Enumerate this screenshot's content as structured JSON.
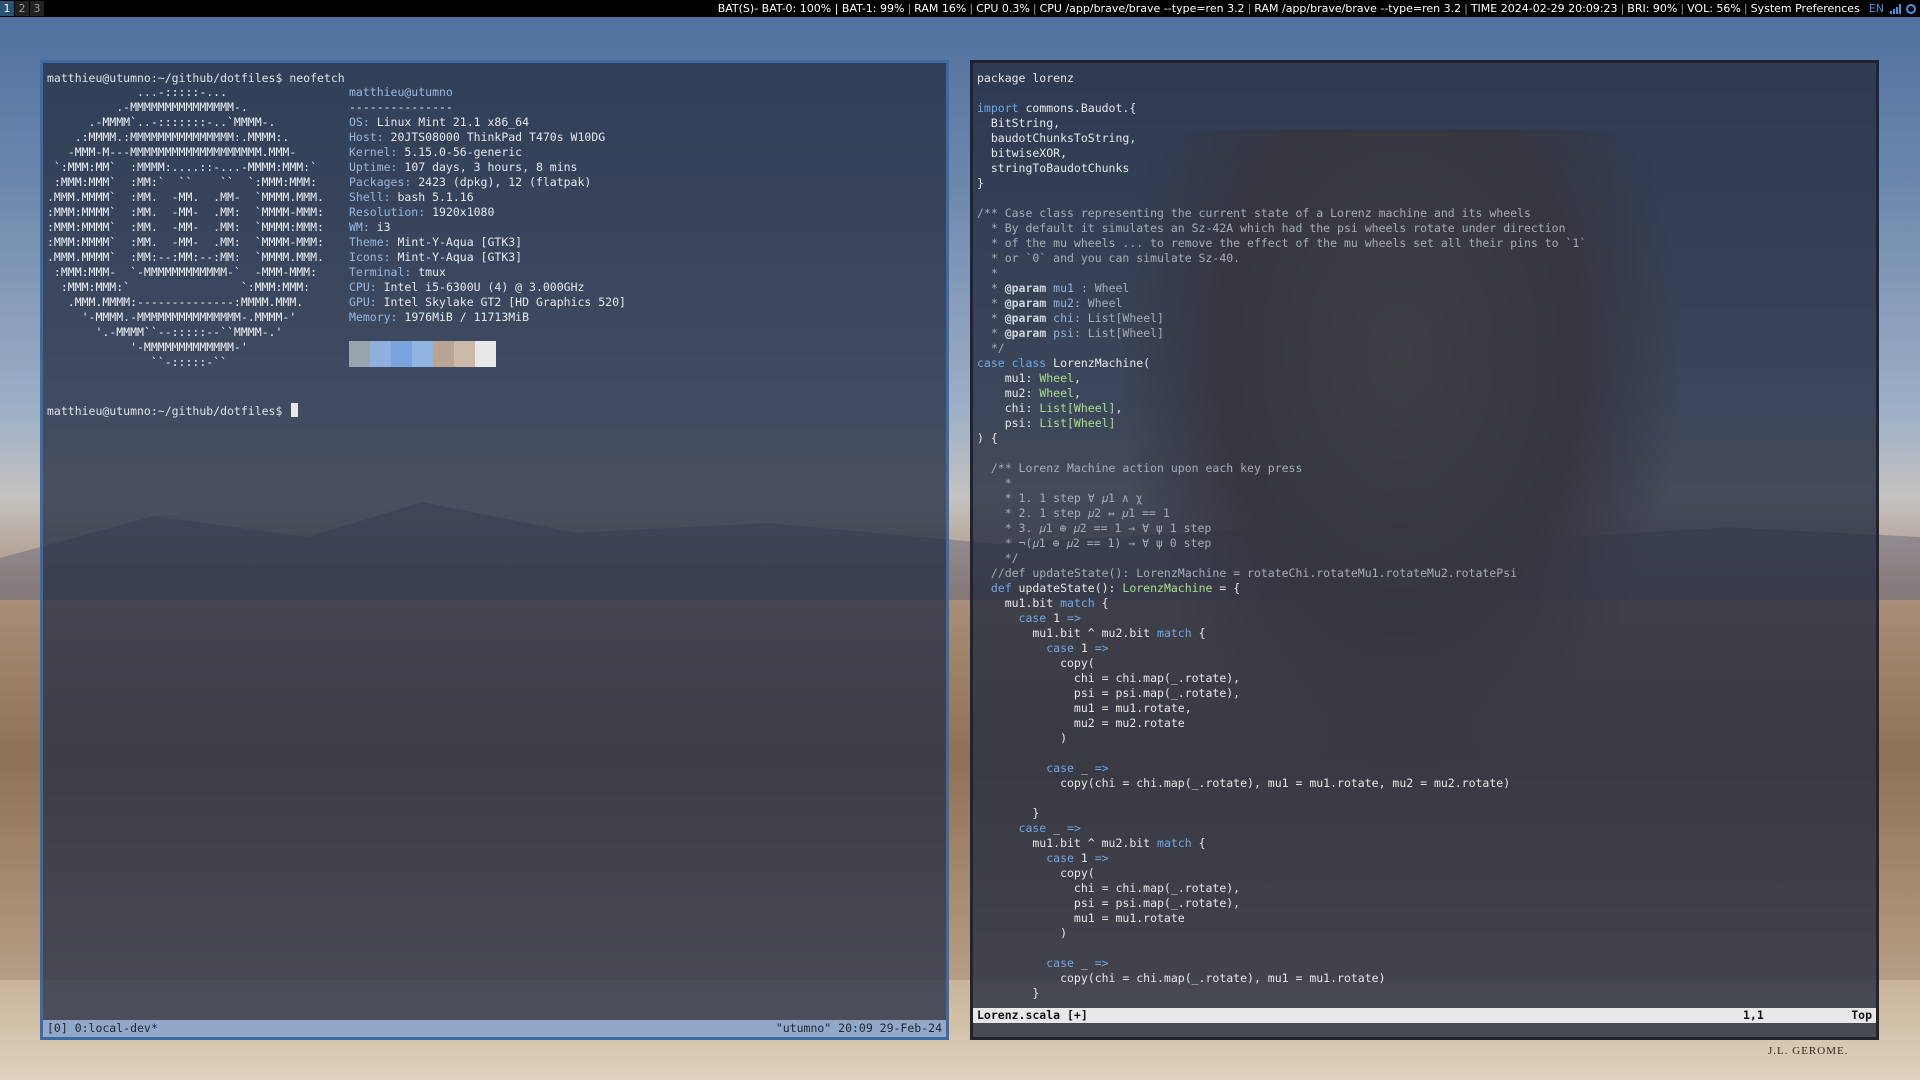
{
  "topbar": {
    "workspaces": [
      "1",
      "2",
      "3"
    ],
    "status": [
      "BAT(S)- BAT-0: 100% | BAT-1: 99%",
      "RAM 16%",
      "CPU 0.3%",
      "CPU /app/brave/brave --type=ren 3.2",
      "RAM /app/brave/brave --type=ren 3.2",
      "TIME 2024-02-29 20:09:23",
      "BRI: 90%",
      "VOL: 56%",
      "System Preferences"
    ],
    "lang": "EN",
    "tray_icons": [
      "signal-bars-icon",
      "audio-icon"
    ]
  },
  "terminal": {
    "prompt_cmd": "matthieu@utumno:~/github/dotfiles$ neofetch",
    "prompt_empty": "matthieu@utumno:~/github/dotfiles$ ",
    "user_host": "matthieu@utumno",
    "separator": "---------------",
    "info": [
      {
        "k": "OS",
        "v": "Linux Mint 21.1 x86_64"
      },
      {
        "k": "Host",
        "v": "20JTS08000 ThinkPad T470s W10DG"
      },
      {
        "k": "Kernel",
        "v": "5.15.0-56-generic"
      },
      {
        "k": "Uptime",
        "v": "107 days, 3 hours, 8 mins"
      },
      {
        "k": "Packages",
        "v": "2423 (dpkg), 12 (flatpak)"
      },
      {
        "k": "Shell",
        "v": "bash 5.1.16"
      },
      {
        "k": "Resolution",
        "v": "1920x1080"
      },
      {
        "k": "WM",
        "v": "i3"
      },
      {
        "k": "Theme",
        "v": "Mint-Y-Aqua [GTK3]"
      },
      {
        "k": "Icons",
        "v": "Mint-Y-Aqua [GTK3]"
      },
      {
        "k": "Terminal",
        "v": "tmux"
      },
      {
        "k": "CPU",
        "v": "Intel i5-6300U (4) @ 3.000GHz"
      },
      {
        "k": "GPU",
        "v": "Intel Skylake GT2 [HD Graphics 520]"
      },
      {
        "k": "Memory",
        "v": "1976MiB / 11713MiB"
      }
    ],
    "ascii": [
      "             ...-:::::-...",
      "          .-MMMMMMMMMMMMMMM-.",
      "      .-MMMM`..-:::::::-..`MMMM-.",
      "    .:MMMM.:MMMMMMMMMMMMMMM:.MMMM:.",
      "   -MMM-M---MMMMMMMMMMMMMMMMMMM.MMM-",
      " `:MMM:MM`  :MMMM:....::-...-MMMM:MMM:`",
      " :MMM:MMM`  :MM:`  ``    ``  `:MMM:MMM:",
      ".MMM.MMMM`  :MM.  -MM.  .MM-  `MMMM.MMM.",
      ":MMM:MMMM`  :MM.  -MM-  .MM:  `MMMM-MMM:",
      ":MMM:MMMM`  :MM.  -MM-  .MM:  `MMMM:MMM:",
      ":MMM:MMMM`  :MM.  -MM-  .MM:  `MMMM-MMM:",
      ".MMM.MMMM`  :MM:--:MM:--:MM:  `MMMM.MMM.",
      " :MMM:MMM-  `-MMMMMMMMMMMM-`  -MMM-MMM:",
      "  :MMM:MMM:`                `:MMM:MMM:",
      "   .MMM.MMMM:--------------:MMMM.MMM.",
      "     '-MMMM.-MMMMMMMMMMMMMMM-.MMMM-'",
      "       '.-MMMM``--:::::--``MMMM-.'",
      "            '-MMMMMMMMMMMMM-'",
      "               ``-:::::-``"
    ],
    "palette": [
      "#9aa3b0",
      "#8fb0dd",
      "#7aa4db",
      "#8fb6e3",
      "#b9a596",
      "#cdb9a8",
      "#e8e8e8"
    ],
    "tmux_left": "[0] 0:local-dev*",
    "tmux_right": "\"utumno\" 20:09 29-Feb-24"
  },
  "editor": {
    "filename": "Lorenz.scala [+]",
    "position": "1,1",
    "scroll": "Top",
    "lines": [
      [
        [
          "t",
          "package lorenz"
        ]
      ],
      [],
      [
        [
          "k",
          "import"
        ],
        [
          "t",
          " commons.Baudot.{"
        ]
      ],
      [
        [
          "t",
          "  BitString,"
        ]
      ],
      [
        [
          "t",
          "  baudotChunksToString,"
        ]
      ],
      [
        [
          "t",
          "  bitwiseXOR,"
        ]
      ],
      [
        [
          "t",
          "  stringToBaudotChunks"
        ]
      ],
      [
        [
          "t",
          "}"
        ]
      ],
      [],
      [
        [
          "c",
          "/** Case class representing the current state of a Lorenz machine and its wheels"
        ]
      ],
      [
        [
          "c",
          "  * By default it simulates an Sz-42A which had the psi wheels rotate under direction"
        ]
      ],
      [
        [
          "c",
          "  * of the mu wheels ... to remove the effect of the mu wheels set all their pins to `1`"
        ]
      ],
      [
        [
          "c",
          "  * or `0` and you can simulate Sz-40."
        ]
      ],
      [
        [
          "c",
          "  *"
        ]
      ],
      [
        [
          "c",
          "  * "
        ],
        [
          "ck",
          "@param"
        ],
        [
          "cv",
          " mu1"
        ],
        [
          "c",
          " : Wheel"
        ]
      ],
      [
        [
          "c",
          "  * "
        ],
        [
          "ck",
          "@param"
        ],
        [
          "cv",
          " mu2"
        ],
        [
          "c",
          ": Wheel"
        ]
      ],
      [
        [
          "c",
          "  * "
        ],
        [
          "ck",
          "@param"
        ],
        [
          "cv",
          " chi"
        ],
        [
          "c",
          ": List[Wheel]"
        ]
      ],
      [
        [
          "c",
          "  * "
        ],
        [
          "ck",
          "@param"
        ],
        [
          "cv",
          " psi"
        ],
        [
          "c",
          ": List[Wheel]"
        ]
      ],
      [
        [
          "c",
          "  */"
        ]
      ],
      [
        [
          "k",
          "case class"
        ],
        [
          "t",
          " LorenzMachine("
        ]
      ],
      [
        [
          "t",
          "    mu1: "
        ],
        [
          "y",
          "Wheel"
        ],
        [
          "t",
          ","
        ]
      ],
      [
        [
          "t",
          "    mu2: "
        ],
        [
          "y",
          "Wheel"
        ],
        [
          "t",
          ","
        ]
      ],
      [
        [
          "t",
          "    chi: "
        ],
        [
          "y",
          "List[Wheel]"
        ],
        [
          "t",
          ","
        ]
      ],
      [
        [
          "t",
          "    psi: "
        ],
        [
          "y",
          "List[Wheel]"
        ]
      ],
      [
        [
          "t",
          ") {"
        ]
      ],
      [],
      [
        [
          "c",
          "  /** Lorenz Machine action upon each key press"
        ]
      ],
      [
        [
          "c",
          "    *"
        ]
      ],
      [
        [
          "c",
          "    * 1. 1 step ∀ 𝜇1 ∧ χ"
        ]
      ],
      [
        [
          "c",
          "    * 2. 1 step 𝜇2 ↔ 𝜇1 == 1"
        ]
      ],
      [
        [
          "c",
          "    * 3. 𝜇1 ⊕ 𝜇2 == 1 → ∀ ψ 1 step"
        ]
      ],
      [
        [
          "c",
          "    * ¬(𝜇1 ⊕ 𝜇2 == 1) → ∀ ψ 0 step"
        ]
      ],
      [
        [
          "c",
          "    */"
        ]
      ],
      [
        [
          "c",
          "  //def updateState(): LorenzMachine = rotateChi.rotateMu1.rotateMu2.rotatePsi"
        ]
      ],
      [
        [
          "k",
          "  def"
        ],
        [
          "t",
          " updateState(): "
        ],
        [
          "y",
          "LorenzMachine"
        ],
        [
          "t",
          " = {"
        ]
      ],
      [
        [
          "t",
          "    mu1.bit "
        ],
        [
          "k",
          "match"
        ],
        [
          "t",
          " {"
        ]
      ],
      [
        [
          "k",
          "      case"
        ],
        [
          "t",
          " 1 "
        ],
        [
          "k",
          "=>"
        ]
      ],
      [
        [
          "t",
          "        mu1.bit ^ mu2.bit "
        ],
        [
          "k",
          "match"
        ],
        [
          "t",
          " {"
        ]
      ],
      [
        [
          "k",
          "          case"
        ],
        [
          "t",
          " 1 "
        ],
        [
          "k",
          "=>"
        ]
      ],
      [
        [
          "t",
          "            copy("
        ]
      ],
      [
        [
          "t",
          "              chi = chi.map(_.rotate),"
        ]
      ],
      [
        [
          "t",
          "              psi = psi.map(_.rotate),"
        ]
      ],
      [
        [
          "t",
          "              mu1 = mu1.rotate,"
        ]
      ],
      [
        [
          "t",
          "              mu2 = mu2.rotate"
        ]
      ],
      [
        [
          "t",
          "            )"
        ]
      ],
      [],
      [
        [
          "k",
          "          case"
        ],
        [
          "t",
          " _ "
        ],
        [
          "k",
          "=>"
        ]
      ],
      [
        [
          "t",
          "            copy(chi = chi.map(_.rotate), mu1 = mu1.rotate, mu2 = mu2.rotate)"
        ]
      ],
      [],
      [
        [
          "t",
          "        }"
        ]
      ],
      [
        [
          "k",
          "      case"
        ],
        [
          "t",
          " _ "
        ],
        [
          "k",
          "=>"
        ]
      ],
      [
        [
          "t",
          "        mu1.bit ^ mu2.bit "
        ],
        [
          "k",
          "match"
        ],
        [
          "t",
          " {"
        ]
      ],
      [
        [
          "k",
          "          case"
        ],
        [
          "t",
          " 1 "
        ],
        [
          "k",
          "=>"
        ]
      ],
      [
        [
          "t",
          "            copy("
        ]
      ],
      [
        [
          "t",
          "              chi = chi.map(_.rotate),"
        ]
      ],
      [
        [
          "t",
          "              psi = psi.map(_.rotate),"
        ]
      ],
      [
        [
          "t",
          "              mu1 = mu1.rotate"
        ]
      ],
      [
        [
          "t",
          "            )"
        ]
      ],
      [],
      [
        [
          "k",
          "          case"
        ],
        [
          "t",
          " _ "
        ],
        [
          "k",
          "=>"
        ]
      ],
      [
        [
          "t",
          "            copy(chi = chi.map(_.rotate), mu1 = mu1.rotate)"
        ]
      ],
      [
        [
          "t",
          "        }"
        ]
      ]
    ]
  },
  "wallpaper": {
    "signature": "J.L. GEROME."
  }
}
